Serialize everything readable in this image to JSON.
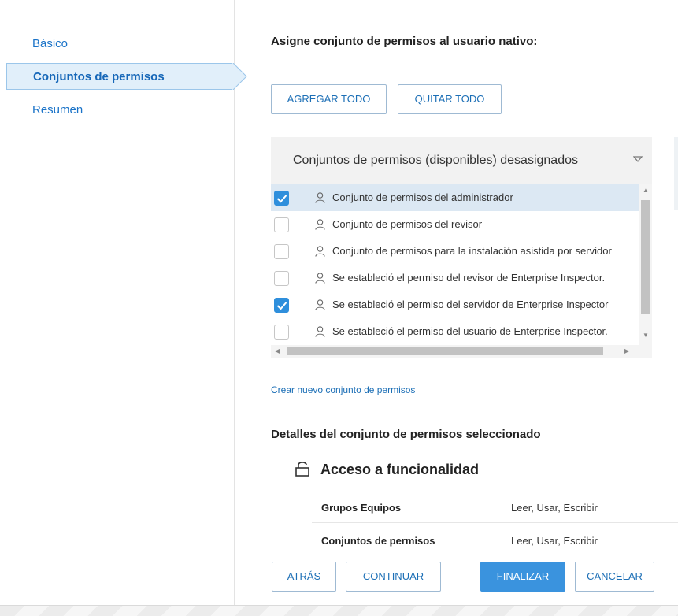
{
  "sidebar": {
    "items": [
      {
        "label": "Básico"
      },
      {
        "label": "Conjuntos de permisos"
      },
      {
        "label": "Resumen"
      }
    ]
  },
  "main": {
    "title": "Asigne conjunto de permisos al usuario nativo:",
    "add_all_label": "AGREGAR TODO",
    "remove_all_label": "QUITAR TODO",
    "list_header": "Conjuntos de permisos (disponibles) desasignados",
    "rows": [
      {
        "label": "Conjunto de permisos del administrador",
        "checked": true
      },
      {
        "label": "Conjunto de permisos del revisor",
        "checked": false
      },
      {
        "label": "Conjunto de permisos para la instalación asistida por servidor",
        "checked": false
      },
      {
        "label": "Se estableció el permiso del revisor de Enterprise Inspector.",
        "checked": false
      },
      {
        "label": "Se estableció el permiso del servidor de Enterprise Inspector",
        "checked": true
      },
      {
        "label": "Se estableció el permiso del usuario de Enterprise Inspector.",
        "checked": false
      }
    ],
    "create_link": "Crear nuevo conjunto de permisos",
    "details_title": "Detalles del conjunto de permisos seleccionado",
    "access_title": "Acceso a funcionalidad",
    "permissions": [
      {
        "name": "Grupos Equipos",
        "value": "Leer, Usar, Escribir"
      },
      {
        "name": "Conjuntos de permisos",
        "value": "Leer, Usar, Escribir"
      }
    ]
  },
  "footer": {
    "back_label": "ATRÁS",
    "continue_label": "CONTINUAR",
    "finish_label": "FINALIZAR",
    "cancel_label": "CANCELAR"
  },
  "colors": {
    "accent": "#1c6fb6",
    "primary_button": "#3a93de",
    "selected_nav_bg": "#e1effa",
    "selected_row_bg": "#dce8f3"
  }
}
